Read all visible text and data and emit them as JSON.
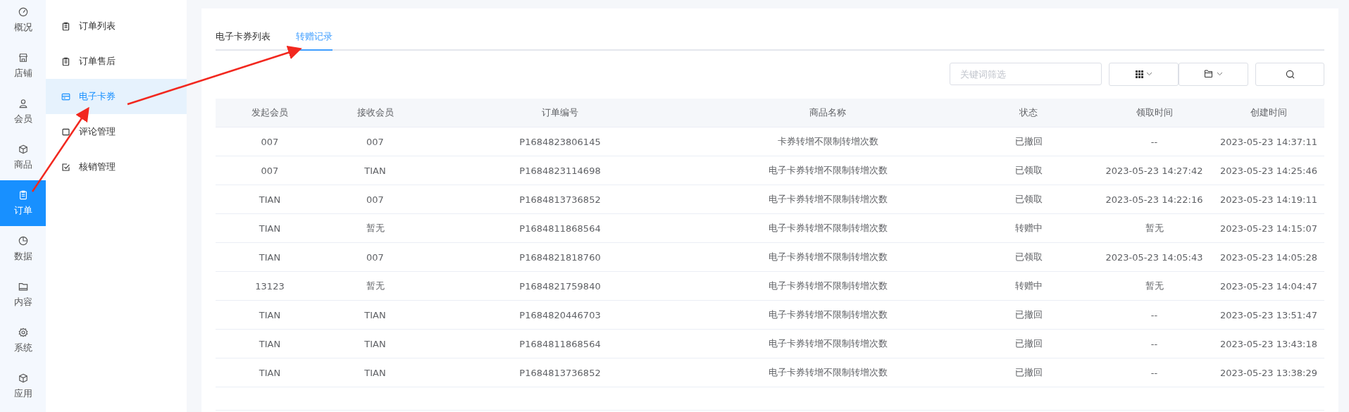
{
  "rail": [
    {
      "label": "概况",
      "kind": "gauge",
      "selected": false
    },
    {
      "label": "店铺",
      "kind": "store",
      "selected": false
    },
    {
      "label": "会员",
      "kind": "user",
      "selected": false
    },
    {
      "label": "商品",
      "kind": "box",
      "selected": false
    },
    {
      "label": "订单",
      "kind": "clipboard",
      "selected": true
    },
    {
      "label": "数据",
      "kind": "pie",
      "selected": false
    },
    {
      "label": "内容",
      "kind": "folder",
      "selected": false
    },
    {
      "label": "系统",
      "kind": "gear",
      "selected": false
    },
    {
      "label": "应用",
      "kind": "box",
      "selected": false
    }
  ],
  "submenu": [
    {
      "label": "订单列表",
      "kind": "clipboard",
      "selected": false
    },
    {
      "label": "订单售后",
      "kind": "clipboard",
      "selected": false
    },
    {
      "label": "电子卡券",
      "kind": "card",
      "selected": true
    },
    {
      "label": "评论管理",
      "kind": "square",
      "selected": false
    },
    {
      "label": "核销管理",
      "kind": "check",
      "selected": false
    }
  ],
  "tabs": [
    {
      "label": "电子卡券列表",
      "selected": false
    },
    {
      "label": "转赠记录",
      "selected": true
    }
  ],
  "search": {
    "placeholder": "关键词筛选"
  },
  "table": {
    "columns": [
      "发起会员",
      "接收会员",
      "订单编号",
      "商品名称",
      "状态",
      "领取时间",
      "创建时间"
    ],
    "rows": [
      [
        "007",
        "007",
        "P1684823806145",
        "卡券转增不限制转增次数",
        "已撤回",
        "--",
        "2023-05-23 14:37:11"
      ],
      [
        "007",
        "TIAN",
        "P1684823114698",
        "电子卡券转增不限制转增次数",
        "已领取",
        "2023-05-23 14:27:42",
        "2023-05-23 14:25:46"
      ],
      [
        "TIAN",
        "007",
        "P1684813736852",
        "电子卡券转增不限制转增次数",
        "已领取",
        "2023-05-23 14:22:16",
        "2023-05-23 14:19:11"
      ],
      [
        "TIAN",
        "暂无",
        "P1684811868564",
        "电子卡券转增不限制转增次数",
        "转赠中",
        "暂无",
        "2023-05-23 14:15:07"
      ],
      [
        "TIAN",
        "007",
        "P1684821818760",
        "电子卡券转增不限制转增次数",
        "已领取",
        "2023-05-23 14:05:43",
        "2023-05-23 14:05:28"
      ],
      [
        "13123",
        "暂无",
        "P1684821759840",
        "电子卡券转增不限制转增次数",
        "转赠中",
        "暂无",
        "2023-05-23 14:04:47"
      ],
      [
        "TIAN",
        "TIAN",
        "P1684820446703",
        "电子卡券转增不限制转增次数",
        "已撤回",
        "--",
        "2023-05-23 13:51:47"
      ],
      [
        "TIAN",
        "TIAN",
        "P1684811868564",
        "电子卡券转增不限制转增次数",
        "已撤回",
        "--",
        "2023-05-23 13:43:18"
      ],
      [
        "TIAN",
        "TIAN",
        "P1684813736852",
        "电子卡券转增不限制转增次数",
        "已撤回",
        "--",
        "2023-05-23 13:38:29"
      ]
    ]
  }
}
